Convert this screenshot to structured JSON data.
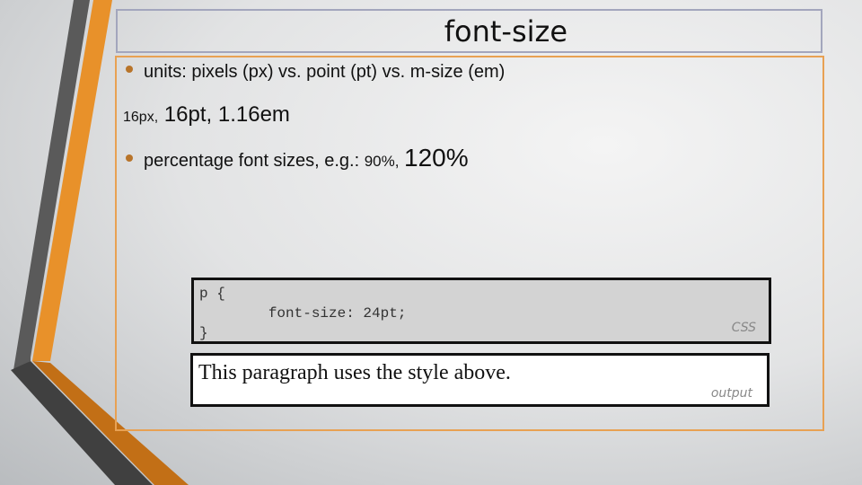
{
  "slide": {
    "title": "font-size",
    "bullets": [
      {
        "text": "units: pixels (px) vs. point (pt) vs. m-size (em)"
      },
      {
        "text": "percentage font sizes, e.g.: ",
        "small": "90%,",
        "large": "120%"
      }
    ],
    "examples_line": {
      "small": "16px,",
      "rest": " 16pt, 1.16em"
    },
    "code": {
      "line1": "p {",
      "line2": "        font-size: 24pt;",
      "line3": "}",
      "label": "CSS"
    },
    "output": {
      "text": "This paragraph uses the style above.",
      "label": "output"
    }
  },
  "colors": {
    "accent": "#e8912a",
    "dark_stripe": "#4a4a4a",
    "bullet": "#b8742a"
  }
}
